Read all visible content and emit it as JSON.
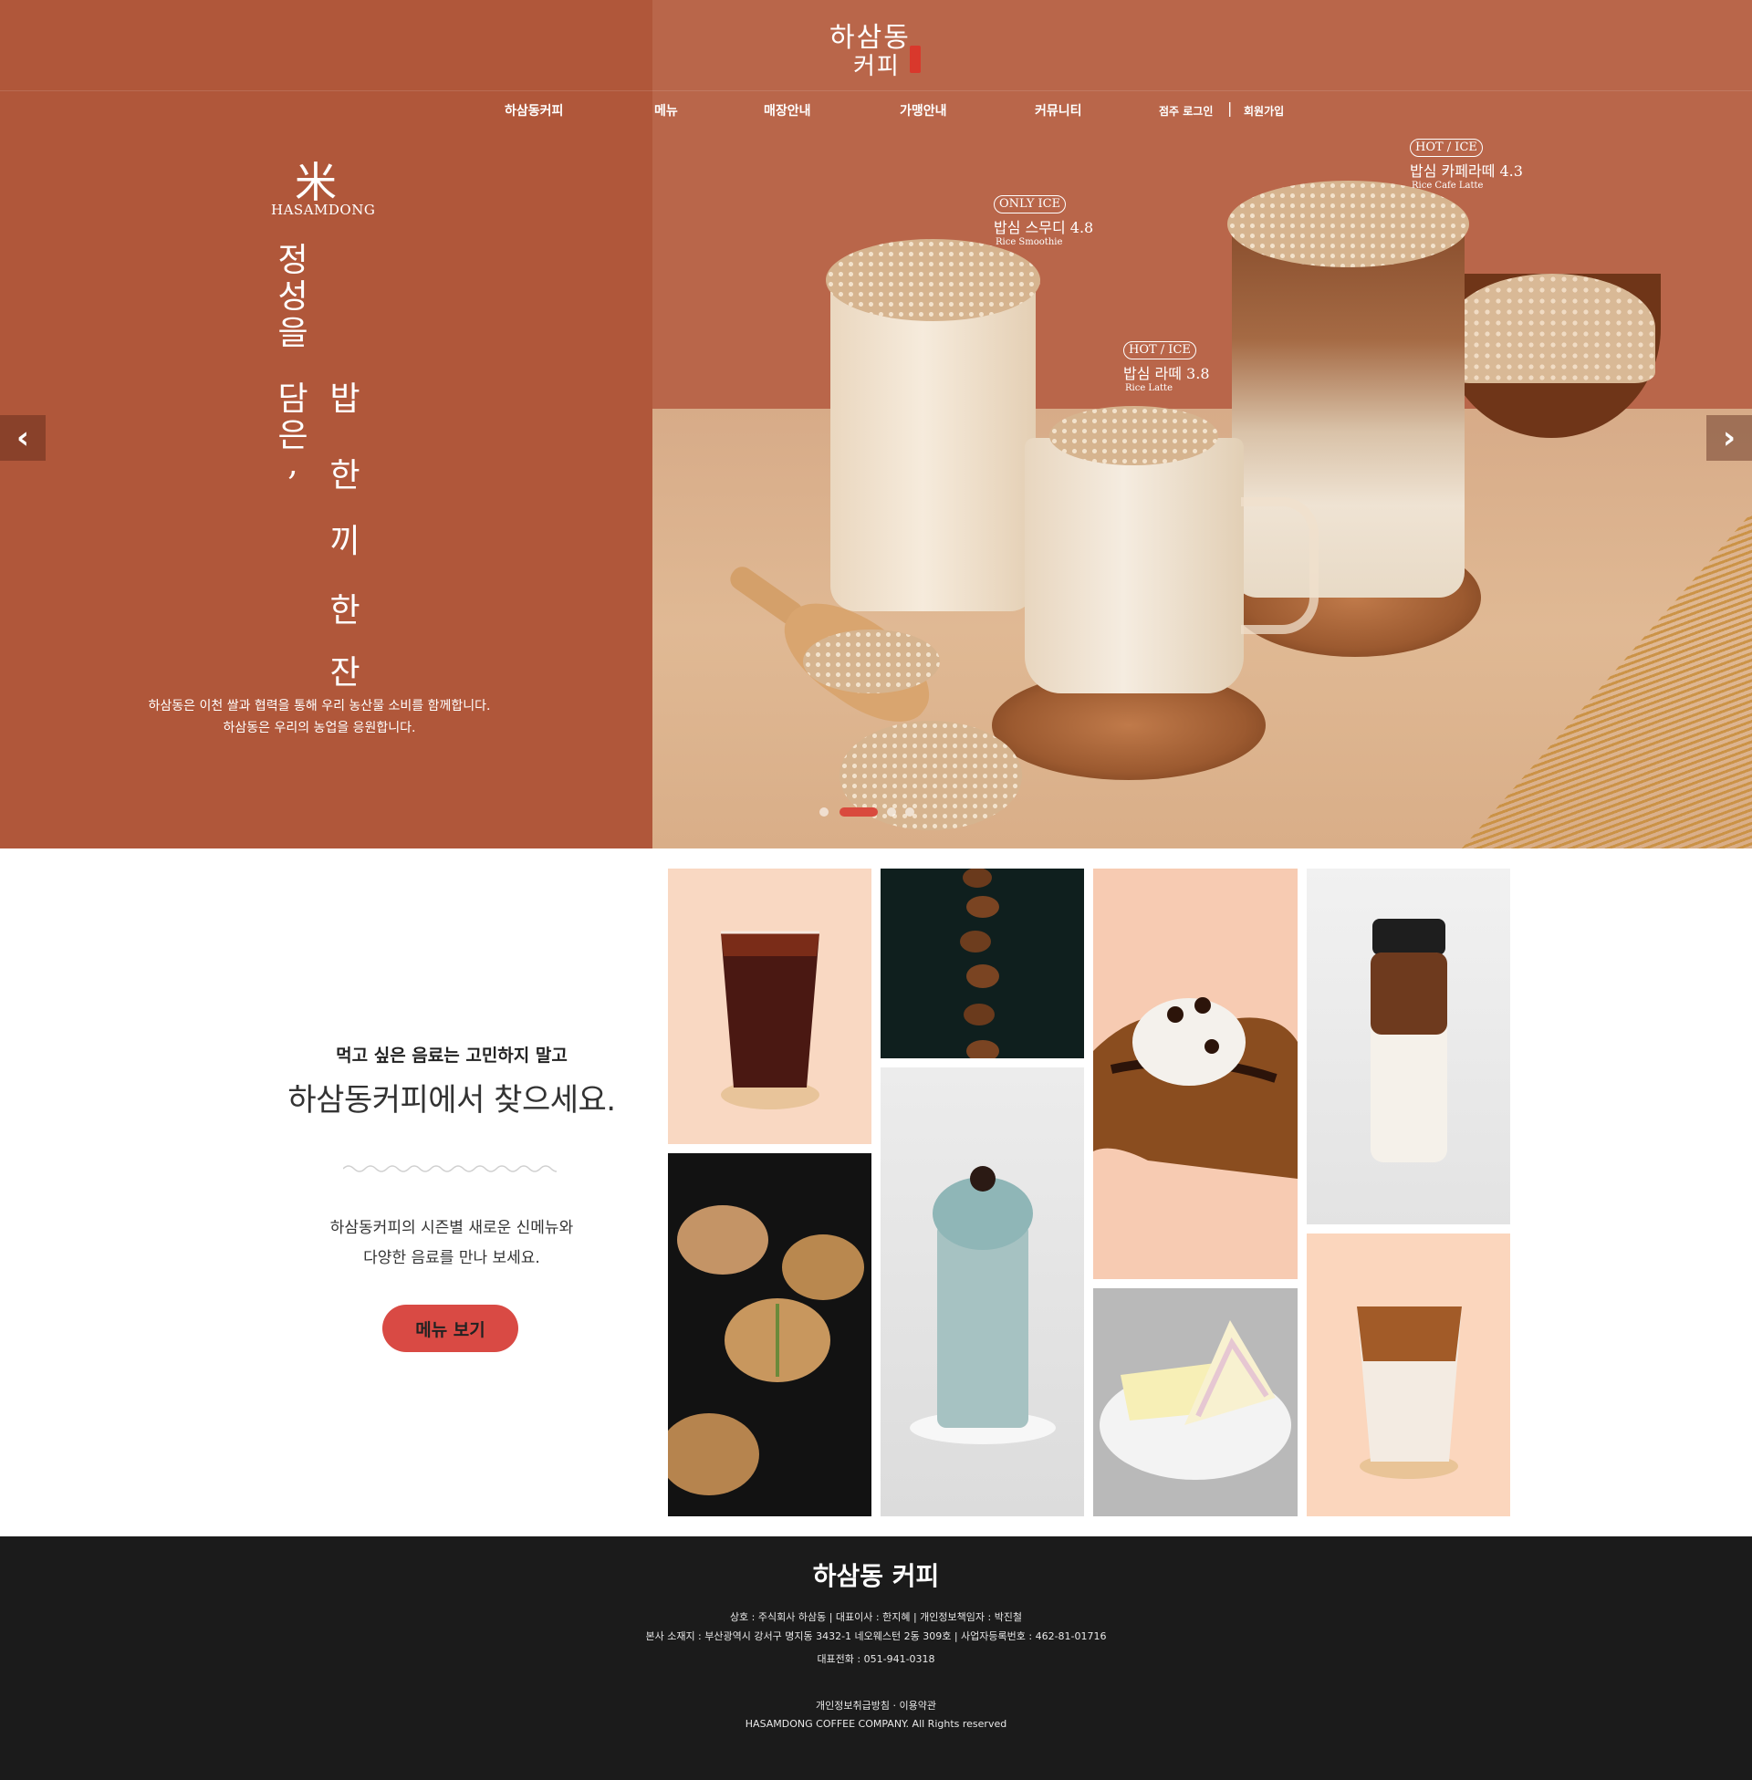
{
  "brand": {
    "logo_line1": "하삼동",
    "logo_line2": "커피"
  },
  "nav": {
    "items": [
      "하삼동커피",
      "메뉴",
      "매장안내",
      "가맹안내",
      "커뮤니티"
    ],
    "login": "점주 로그인",
    "separator": "|",
    "signup": "회원가입"
  },
  "hero": {
    "rice_char": "米",
    "brand_en": "HASAMDONG",
    "vertical_left": [
      "정",
      "성",
      "을",
      "담",
      "은",
      ","
    ],
    "vertical_right": [
      "밥",
      "한",
      "끼",
      "한",
      "잔"
    ],
    "desc_line1": "하삼동은 이천 쌀과 협력을 통해 우리 농산물 소비를 함께합니다.",
    "desc_line2": "하삼동은 우리의 농업을 응원합니다.",
    "prev_arrow": "‹",
    "next_arrow": "›",
    "tags": [
      {
        "badge": "ONLY ICE",
        "name": "밥심 스무디 4.8",
        "en": "Rice Smoothie"
      },
      {
        "badge": "HOT / ICE",
        "name": "밥심 라떼 3.8",
        "en": "Rice Latte"
      },
      {
        "badge": "HOT / ICE",
        "name": "밥심 카페라떼 4.3",
        "en": "Rice Cafe Latte"
      }
    ],
    "slide_count": 4,
    "active_slide": 2
  },
  "promo": {
    "subtitle": "먹고 싶은 음료는 고민하지 말고",
    "title": "하삼동커피에서 찾으세요.",
    "desc_line1": "하삼동커피의 시즌별 새로운 신메뉴와",
    "desc_line2": "다양한 음료를 만나 보세요.",
    "button": "메뉴 보기"
  },
  "footer": {
    "title": "하삼동 커피",
    "line1": "상호 : 주식회사 하삼동  |  대표이사 : 한지혜  |  개인정보책임자 : 박진철",
    "line2": "본사 소재지 : 부산광역시 강서구 명지동 3432-1 네오웨스턴 2동 309호  |  사업자등록번호 : 462-81-01716",
    "line3": "대표전화 : 051-941-0318",
    "line4": "개인정보취급방침 · 이용약관",
    "line5": "HASAMDONG COFFEE COMPANY. All Rights reserved"
  },
  "colors": {
    "hero_left": "#b0573a",
    "hero_right": "#b9664a",
    "accent": "#d94a44",
    "footer_bg": "#1b1b1b"
  },
  "icons": {
    "prev": "chevron-left-icon",
    "next": "chevron-right-icon"
  }
}
